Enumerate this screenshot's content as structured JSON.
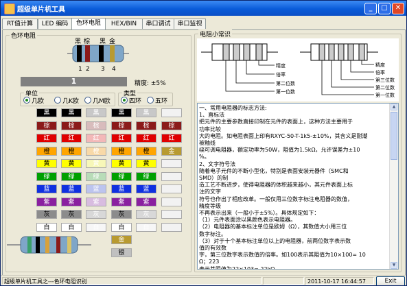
{
  "window": {
    "title": "超级单片机工具",
    "min_glyph": "_",
    "max_glyph": "□",
    "close_glyph": "✕"
  },
  "tabs": [
    "RT值计算",
    "LED 编码",
    "色环电阻",
    "HEX/BIN",
    "串口调试",
    "串口监视"
  ],
  "active_tab": "色环电阻",
  "left": {
    "group_title": "色环电阻",
    "band_names": [
      "黑",
      "棕",
      "黑",
      "金"
    ],
    "band_numbers": [
      "1",
      "2",
      "3",
      "4"
    ],
    "value": "1",
    "tolerance": "精度: ±5%",
    "unit": {
      "title": "单位",
      "options": [
        "几欧",
        "几K欧",
        "几M欧"
      ],
      "selected": 0
    },
    "type": {
      "title": "类型",
      "options": [
        "四环",
        "五环"
      ],
      "selected": 0
    },
    "color_names": [
      "黑",
      "棕",
      "红",
      "橙",
      "黄",
      "绿",
      "蓝",
      "紫",
      "灰",
      "白"
    ],
    "col6_names": [
      "",
      "棕",
      "红",
      "金",
      "",
      "",
      "",
      "",
      "",
      ""
    ],
    "gold_silver": [
      "金",
      "银"
    ]
  },
  "right": {
    "group_title": "电阻小常识",
    "diagram_labels_left": [
      "精度",
      "倍率",
      "第二位数",
      "第一位数"
    ],
    "diagram_labels_right": [
      "精度",
      "倍率",
      "第三位数",
      "第二位数",
      "第一位数"
    ],
    "text_lines": [
      "一、常用电阻器的标志方法:",
      "1、直标法",
      "把元件的主要参数直接印制在元件的表面上，这种方法主要用于",
      "功率比较",
      "大的电阻。如电阻表面上印有RXYC-50-T-1k5-±10%，其含义是耐潮",
      "被釉线",
      "绕可调电阻器，额定功率为50W，阻值为1.5kΩ，允许误差为±10",
      "%。",
      "2、文字符号法",
      "随着电子元件的不断小型化，特别是表面安装元器件（SMC和",
      "SMD）的制",
      "造工艺不断进步，使得电阻器的体积越来越小，其元件表面上标",
      "注的文字",
      "符号也作出了相应改革。一般仅用三位数字标注电阻器的数值，",
      "精度等级",
      "不再表示出来（一般小于±5%）。具体规定如下：",
      "（1）元件表面涂以黑颜色表示电阻器。",
      "（2）电阻器的基本标注单位是欧姆（Ω），其数值大小用三位",
      "数字标注。",
      "（3）对于十个基本标注单位以上的电阻器，前两位数字表示数",
      "值的有效数",
      "字，第三位数字表示数值的倍率。如100表示其阻值为10×100= 10",
      "Ω；223",
      "表示其阻值为22×103= 22kΩ。"
    ]
  },
  "status": {
    "app_text": "超级单片机工具之---色环电阻识别",
    "datetime": "2011-10-17  16:44:57",
    "exit_label": "Exit"
  },
  "colors": {
    "black": "#000000",
    "brown": "#8b1a1a",
    "red": "#e00000",
    "orange": "#ffa500",
    "yellow": "#ffff00",
    "green": "#00a000",
    "blue": "#1030e0",
    "violet": "#8a20a0",
    "gray": "#8c8c8c",
    "white": "#ffffff",
    "gold": "#b89a30",
    "silver": "#c0c0c0"
  }
}
